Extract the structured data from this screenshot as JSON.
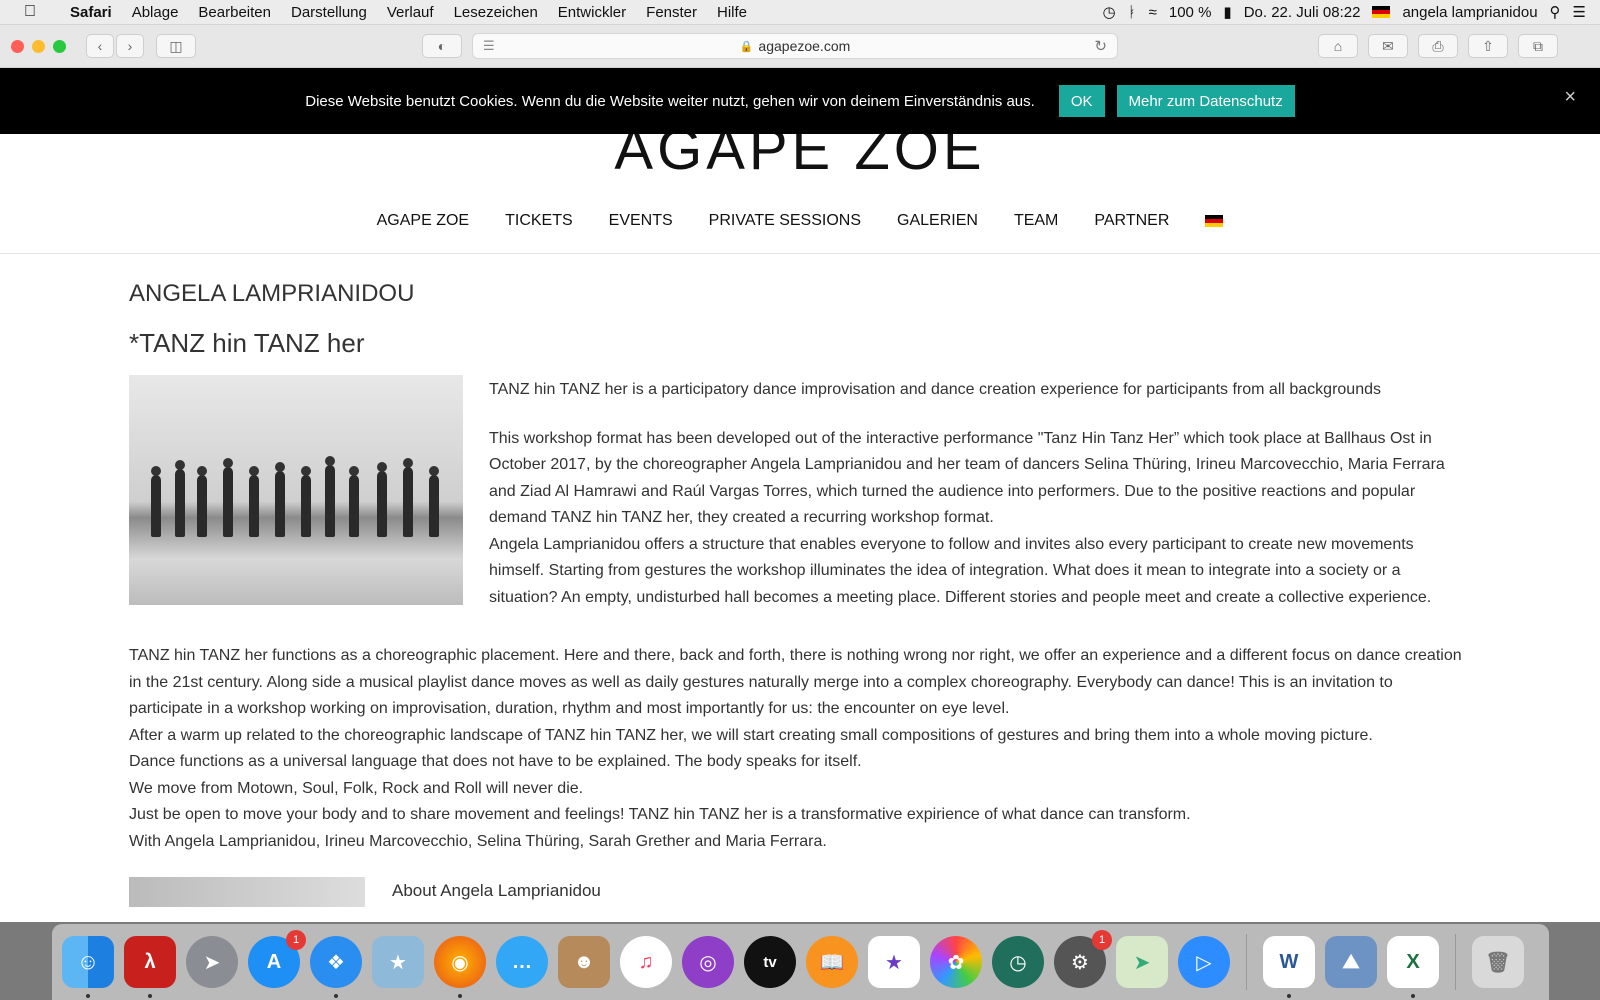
{
  "menubar": {
    "app": "Safari",
    "items": [
      "Ablage",
      "Bearbeiten",
      "Darstellung",
      "Verlauf",
      "Lesezeichen",
      "Entwickler",
      "Fenster",
      "Hilfe"
    ],
    "battery": "100 %",
    "datetime": "Do. 22. Juli  08:22",
    "user": "angela lamprianidou"
  },
  "browser": {
    "url": "agapezoe.com"
  },
  "cookie": {
    "message": "Diese Website benutzt Cookies. Wenn du die Website weiter nutzt, gehen wir von deinem Einverständnis aus.",
    "ok": "OK",
    "privacy": "Mehr zum Datenschutz",
    "close": "×"
  },
  "site": {
    "logo": "AGAPE ZOE",
    "nav": [
      "AGAPE ZOE",
      "TICKETS",
      "EVENTS",
      "PRIVATE SESSIONS",
      "GALERIEN",
      "TEAM",
      "PARTNER"
    ]
  },
  "content": {
    "heading": "ANGELA LAMPRIANIDOU",
    "subheading": "*TANZ hin TANZ her",
    "intro": "TANZ hin TANZ her is a participatory dance improvisation and dance creation experience for participants from all backgrounds",
    "para1": "This workshop format has been developed out of the interactive performance \"Tanz Hin Tanz Her” which took place at Ballhaus Ost in October 2017, by the choreographer Angela Lamprianidou and her team of dancers Selina Thüring, Irineu Marcovecchio, Maria Ferrara and Ziad Al Hamrawi and Raúl Vargas Torres, which turned the audience into performers. Due to the positive reactions and popular demand TANZ hin TANZ her, they created a recurring workshop format.",
    "para2": "Angela Lamprianidou offers a structure that enables everyone to follow and invites also every participant to create new movements himself. Starting from gestures the workshop illuminates the idea of integration. What does it mean to integrate into a society or a situation? An empty, undisturbed hall becomes a meeting place. Different stories and people meet and create a collective experience.",
    "para3": "TANZ hin TANZ her functions as a choreographic placement. Here and there, back and forth, there is nothing wrong nor right, we offer an experience and a different focus on dance creation in the 21st century. Along side a musical playlist dance moves as well as daily gestures naturally merge into a complex choreography. Everybody can dance! This is an invitation to participate in a workshop working on improvisation, duration, rhythm and most importantly for us: the encounter on eye level.",
    "para4": "After a warm up related to the choreographic landscape of TANZ hin TANZ her, we will start creating small compositions of gestures and bring them into a whole moving picture.",
    "para5": "Dance functions as a universal language that does not have to be explained. The body speaks for itself.",
    "para6": "We move from Motown, Soul, Folk, Rock and Roll will never die.",
    "para7": "Just be open to move your body and to share movement and feelings! TANZ hin TANZ her is a transformative expirience of what dance can transform.",
    "para8": "With Angela Lamprianidou, Irineu Marcovecchio, Selina Thüring, Sarah Grether and  Maria Ferrara.",
    "about": "About Angela Lamprianidou"
  },
  "dock": {
    "appstore_badge": "1",
    "settings_badge": "1",
    "tv_label": "tv",
    "word_label": "W",
    "excel_label": "X"
  }
}
